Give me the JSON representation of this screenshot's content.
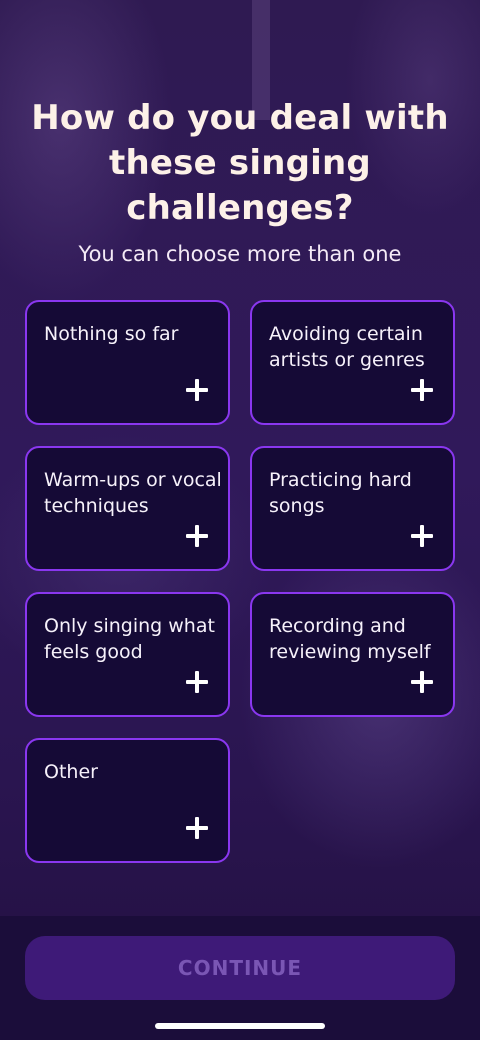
{
  "question": {
    "title": "How do you deal with these singing challenges?",
    "subtitle": "You can choose more than one"
  },
  "options": [
    {
      "label": "Nothing so far",
      "icon": "plus-icon"
    },
    {
      "label": "Avoiding certain artists or genres",
      "icon": "plus-icon"
    },
    {
      "label": "Warm-ups or vocal techniques",
      "icon": "plus-icon"
    },
    {
      "label": "Practicing hard songs",
      "icon": "plus-icon"
    },
    {
      "label": "Only singing what feels good",
      "icon": "plus-icon"
    },
    {
      "label": "Recording and reviewing myself",
      "icon": "plus-icon"
    },
    {
      "label": "Other",
      "icon": "plus-icon"
    }
  ],
  "footer": {
    "continue_label": "CONTINUE"
  },
  "colors": {
    "background": "#2f1a52",
    "card_background": "#150a36",
    "card_border": "#8a37f0",
    "button_background": "#3e1a78",
    "button_text": "#7a56b4",
    "title_text": "#fdf1e8"
  }
}
